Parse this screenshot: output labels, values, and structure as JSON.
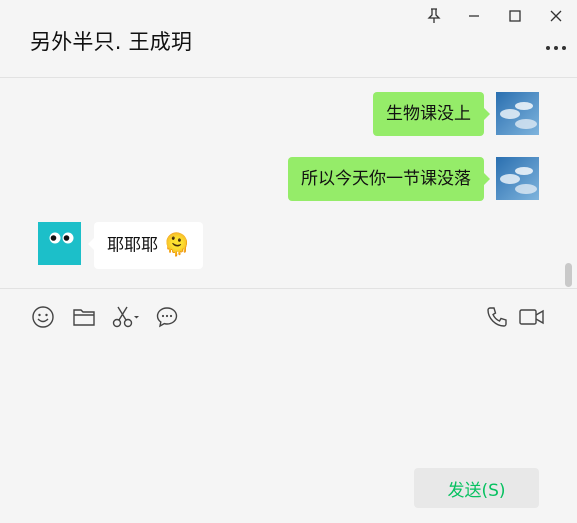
{
  "window": {
    "title": "另外半只. 王成玥",
    "controls": [
      "pin-icon",
      "minimize-icon",
      "maximize-icon",
      "close-icon"
    ],
    "more_icon": "more-icon"
  },
  "messages": [
    {
      "from": "me",
      "text": "生物课没上"
    },
    {
      "from": "me",
      "text": "所以今天你一节课没落"
    },
    {
      "from": "them",
      "text": "耶耶耶",
      "emoji": "🫠"
    }
  ],
  "toolbar": {
    "left": [
      "emoji-icon",
      "folder-icon",
      "scissors-icon",
      "chat-bubble-icon"
    ],
    "right": [
      "phone-icon",
      "video-icon"
    ]
  },
  "input": {
    "value": ""
  },
  "send_button": {
    "label": "发送(S)"
  },
  "colors": {
    "background": "#f5f5f5",
    "my_bubble": "#95ec69",
    "their_bubble": "#ffffff",
    "send_text": "#07c160",
    "send_bg": "#e8e8e8",
    "avatar_them": "#1cbfc9"
  }
}
